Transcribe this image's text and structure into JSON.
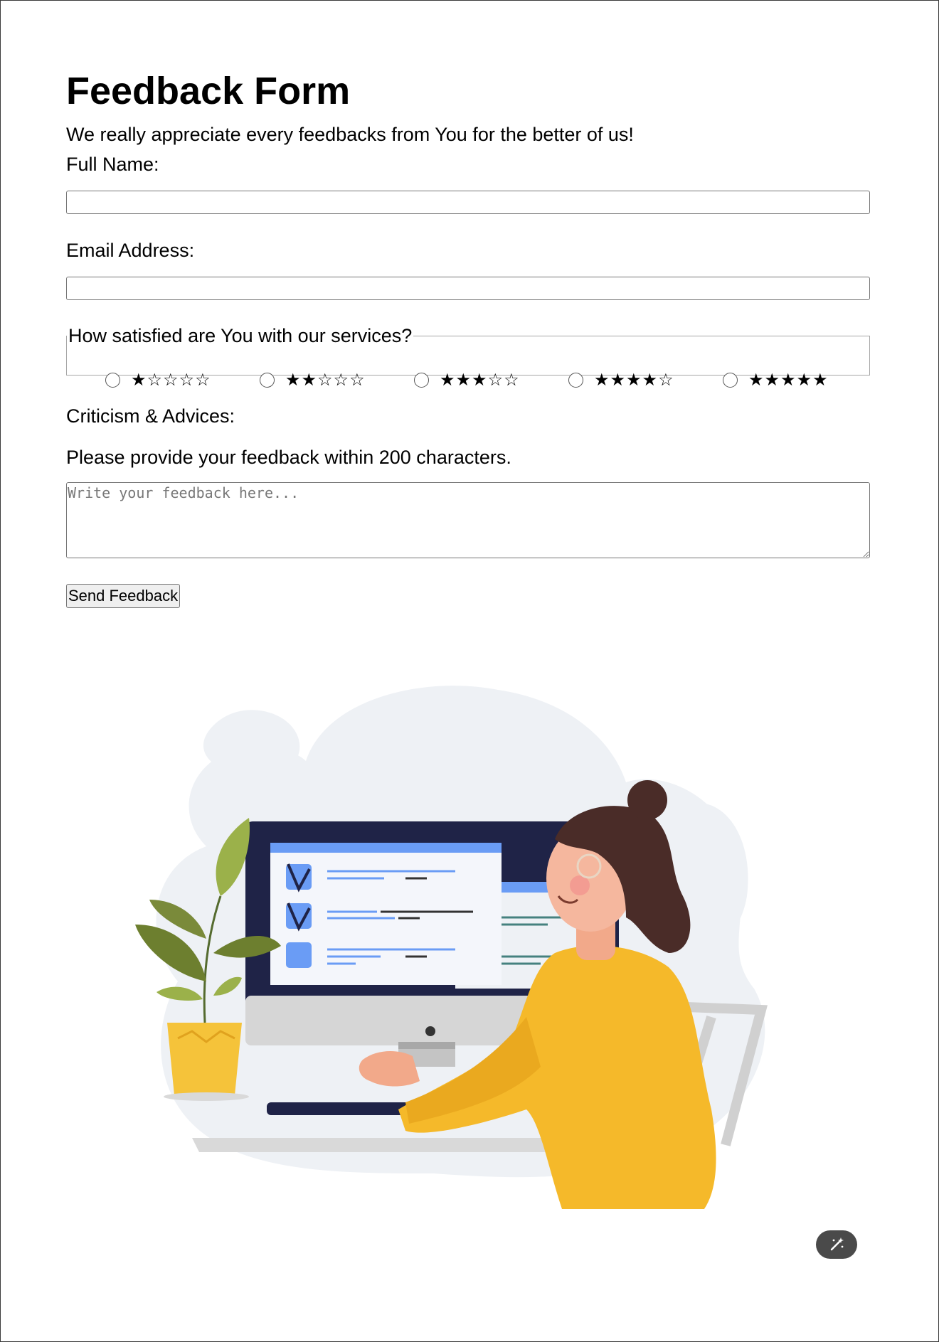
{
  "form": {
    "title": "Feedback Form",
    "subtitle": "We really appreciate every feedbacks from You for the better of us!",
    "full_name_label": "Full Name:",
    "full_name_value": "",
    "email_label": "Email Address:",
    "email_value": "",
    "satisfaction_legend": "How satisfied are You with our services?",
    "ratings": [
      {
        "stars": "★☆☆☆☆",
        "selected": false
      },
      {
        "stars": "★★☆☆☆",
        "selected": false
      },
      {
        "stars": "★★★☆☆",
        "selected": false
      },
      {
        "stars": "★★★★☆",
        "selected": false
      },
      {
        "stars": "★★★★★",
        "selected": false
      }
    ],
    "criticism_label": "Criticism & Advices:",
    "hint": "Please provide your feedback within 200 characters.",
    "feedback_placeholder": "Write your feedback here...",
    "submit_label": "Send Feedback"
  },
  "illustration": {
    "subject": "woman-at-computer-with-checklist",
    "colors": {
      "blob": "#eef1f5",
      "sweater": "#f5b92a",
      "screen": "#1f2347",
      "accent_blue": "#6a9cf5",
      "plant": "#7a8a3a",
      "pot": "#f5c33a"
    }
  },
  "floating_button": {
    "icon": "magic-wand-icon"
  }
}
